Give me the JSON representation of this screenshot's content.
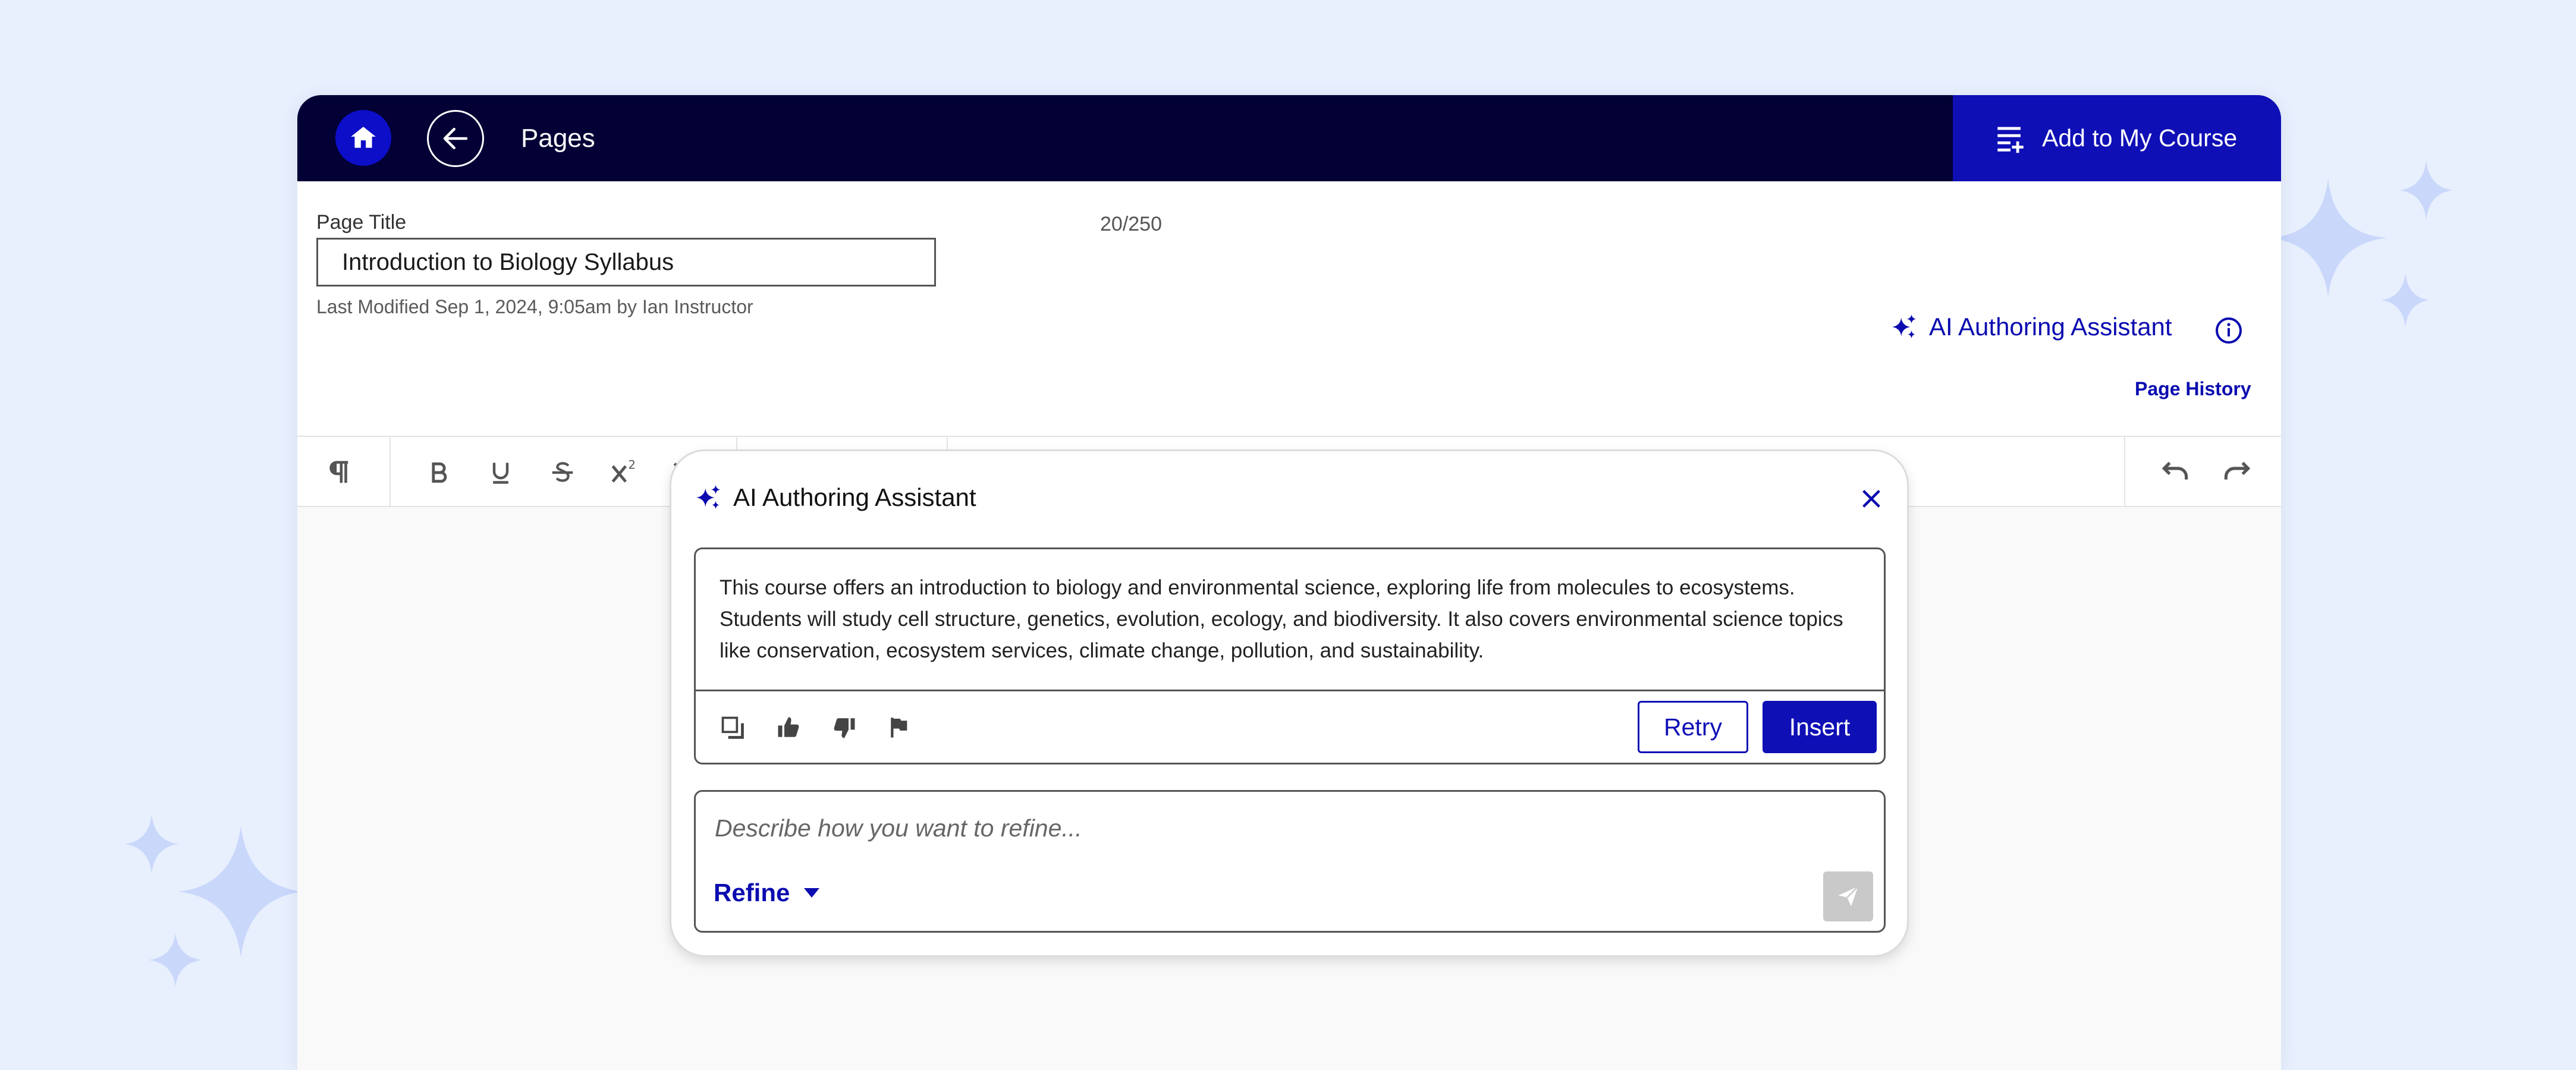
{
  "topbar": {
    "title": "Pages",
    "add_to_course_label": "Add to My Course"
  },
  "page_title": {
    "label": "Page Title",
    "char_count": "20/250",
    "value": "Introduction to Biology Syllabus",
    "last_modified": "Last Modified Sep 1, 2024, 9:05am by Ian Instructor"
  },
  "assistant_link": {
    "label": "AI Authoring Assistant",
    "page_history": "Page History"
  },
  "toolbar": {
    "icons": [
      "paragraph-icon",
      "bold-icon",
      "underline-icon",
      "strikethrough-icon",
      "superscript-icon",
      "subscript-icon",
      "align-icon",
      "list-icon",
      "image-icon",
      "link-icon",
      "sigma-icon",
      "omega-icon",
      "table-icon",
      "media-icon",
      "undo-icon",
      "redo-icon"
    ]
  },
  "assistant_panel": {
    "title": "AI Authoring Assistant",
    "response_text": "This course offers an introduction to biology and environmental science, exploring life from molecules to ecosystems. Students will study cell structure, genetics, evolution, ecology, and biodiversity. It also covers environmental science topics like conservation, ecosystem services, climate change, pollution, and sustainability.",
    "retry_label": "Retry",
    "insert_label": "Insert",
    "refine_placeholder": "Describe how you want to refine...",
    "refine_label": "Refine"
  },
  "colors": {
    "topbar_bg": "#020035",
    "accent": "#0f0fb6",
    "background": "#e8effd"
  }
}
